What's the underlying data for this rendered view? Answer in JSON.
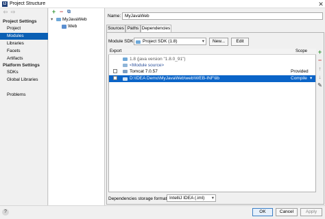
{
  "window": {
    "title": "Project Structure",
    "close": "✕",
    "app_icon": "IJ"
  },
  "nav": {
    "back": "⇦",
    "forward": "⇨"
  },
  "sidebar": {
    "project_settings": "Project Settings",
    "project_items": [
      {
        "label": "Project"
      },
      {
        "label": "Modules",
        "selected": true
      },
      {
        "label": "Libraries"
      },
      {
        "label": "Facets"
      },
      {
        "label": "Artifacts"
      }
    ],
    "platform_settings": "Platform Settings",
    "platform_items": [
      {
        "label": "SDKs"
      },
      {
        "label": "Global Libraries"
      }
    ],
    "problems": "Problems"
  },
  "modules_toolbar": {
    "add": "+",
    "remove": "−",
    "copy": "⧉"
  },
  "tree": {
    "module": "MyJavaWeb",
    "child": "Web"
  },
  "name": {
    "label": "Name:",
    "value": "MyJavaWeb"
  },
  "tabs": [
    {
      "label": "Sources"
    },
    {
      "label": "Paths"
    },
    {
      "label": "Dependencies",
      "active": true
    }
  ],
  "sdk": {
    "label": "Module SDK:",
    "value": "Project SDK (1.8)",
    "new_label": "New...",
    "edit_label": "Edit"
  },
  "table": {
    "headers": {
      "export": "Export",
      "scope": "Scope"
    },
    "rows": [
      {
        "text": "1.8 (java version \"1.8.0_91\")",
        "scope": ""
      },
      {
        "text": "<Module source>",
        "scope": ""
      },
      {
        "text": "Tomcat 7.0.57",
        "scope": "Provided"
      },
      {
        "text": "D:\\IDEA Demo\\MyJavaWeb\\web\\WEB-INF\\lib",
        "scope": "Compile"
      }
    ]
  },
  "side_buttons": {
    "add": "+",
    "remove": "−",
    "up": "↑",
    "down": "↓",
    "edit": "✎"
  },
  "storage": {
    "label": "Dependencies storage format:",
    "value": "IntelliJ IDEA (.iml)"
  },
  "footer": {
    "help": "?",
    "ok": "OK",
    "cancel": "Cancel",
    "apply": "Apply"
  },
  "colors": {
    "selection": "#0a5fb4",
    "add_green": "#3c9a3c",
    "remove_red": "#c84b4b"
  }
}
